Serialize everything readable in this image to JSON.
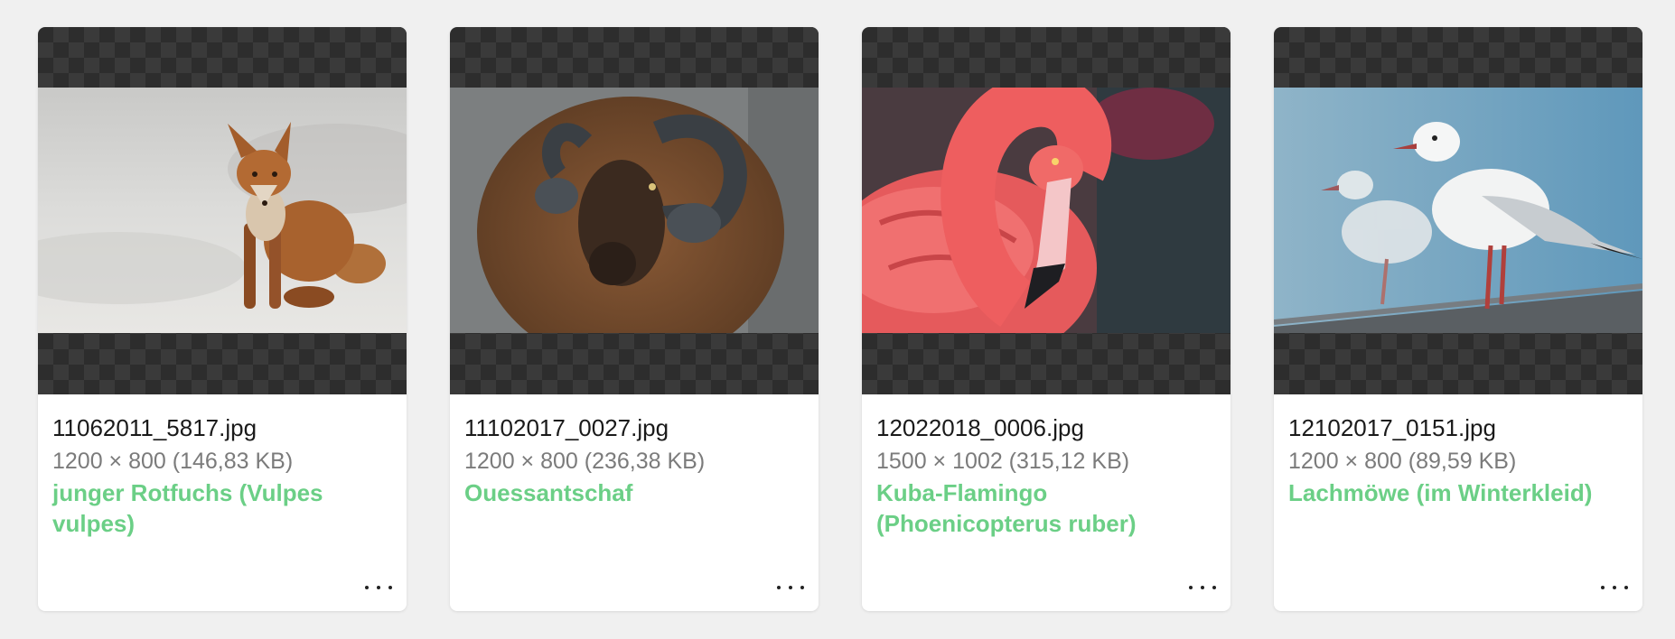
{
  "colors": {
    "background": "#f0f0f0",
    "card": "#ffffff",
    "title_accent": "#6bcf86",
    "meta_text": "#7b7b7b",
    "checker_dark": "#2d2d2d",
    "checker_light": "#3a3a3a"
  },
  "cards": [
    {
      "filename": "11062011_5817.jpg",
      "meta": "1200 × 800 (146,83 KB)",
      "title": "junger Rotfuchs (Vulpes vulpes)",
      "menu_icon": "more-horizontal-icon"
    },
    {
      "filename": "11102017_0027.jpg",
      "meta": "1200 × 800 (236,38 KB)",
      "title": "Ouessantschaf",
      "menu_icon": "more-horizontal-icon"
    },
    {
      "filename": "12022018_0006.jpg",
      "meta": "1500 × 1002 (315,12 KB)",
      "title": "Kuba-Flamingo (Phoenicopterus ruber)",
      "menu_icon": "more-horizontal-icon"
    },
    {
      "filename": "12102017_0151.jpg",
      "meta": "1200 × 800 (89,59 KB)",
      "title": "Lachmöwe (im Winterkleid)",
      "menu_icon": "more-horizontal-icon"
    }
  ]
}
